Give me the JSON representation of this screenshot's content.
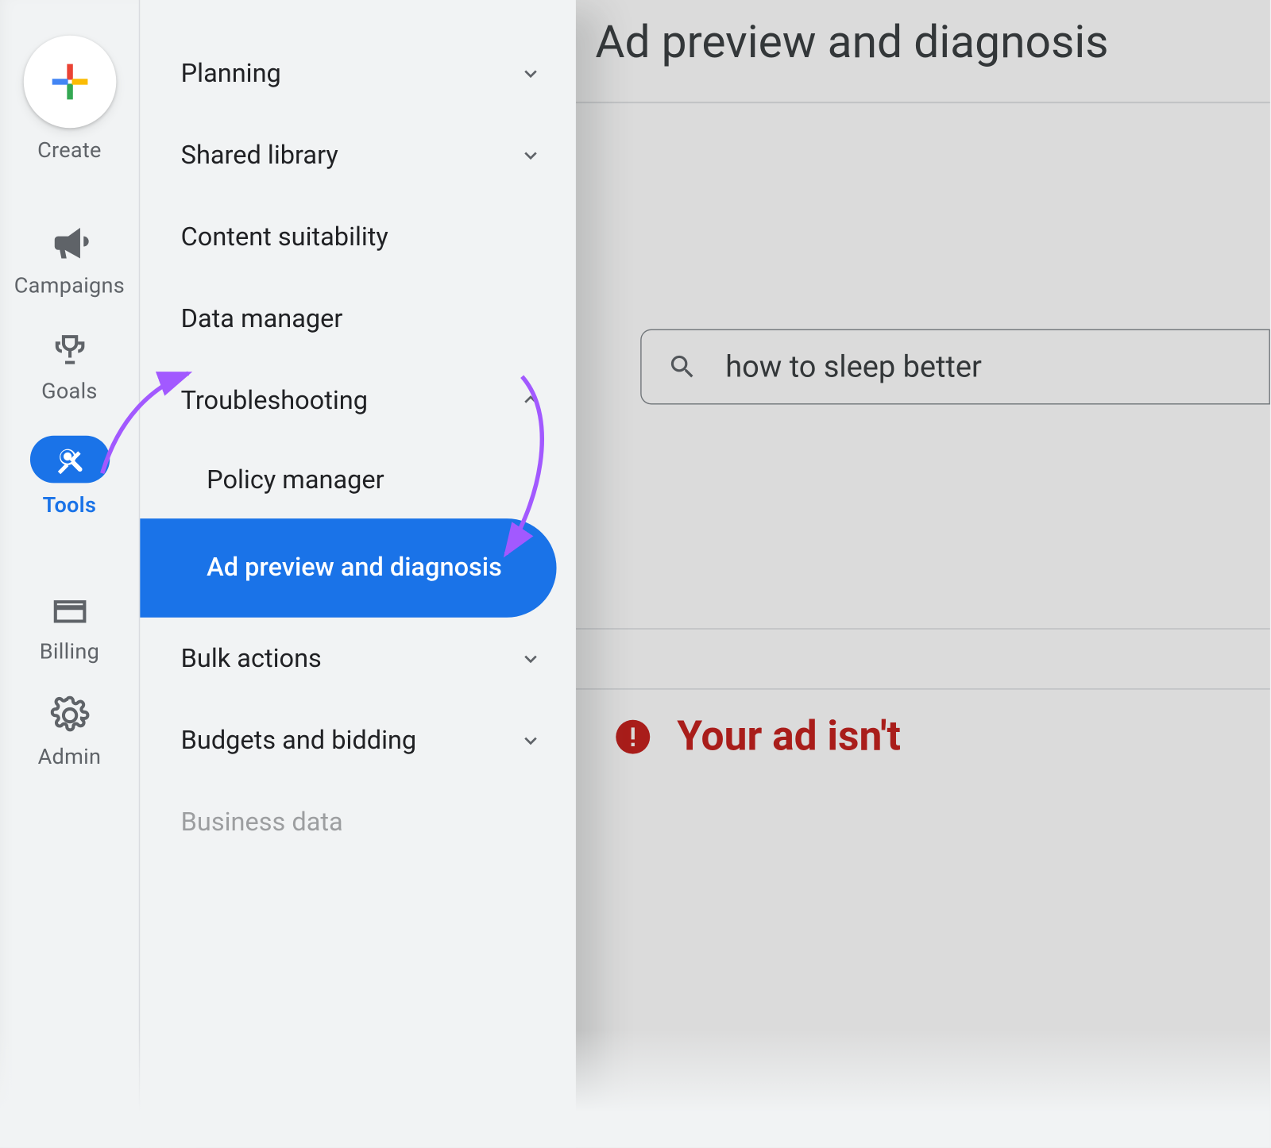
{
  "left_rail": {
    "create": "Create",
    "campaigns": "Campaigns",
    "goals": "Goals",
    "tools": "Tools",
    "billing": "Billing",
    "admin": "Admin"
  },
  "panel": {
    "planning": "Planning",
    "shared_library": "Shared library",
    "content_suitability": "Content suitability",
    "data_manager": "Data manager",
    "troubleshooting": "Troubleshooting",
    "policy_manager": "Policy manager",
    "ad_preview": "Ad preview and diagnosis",
    "bulk_actions": "Bulk actions",
    "budgets_bidding": "Budgets and bidding",
    "business_data": "Business data"
  },
  "main": {
    "title": "Ad preview and diagnosis",
    "search_value": "how to sleep better"
  },
  "alert": {
    "text": "Your ad isn't"
  }
}
